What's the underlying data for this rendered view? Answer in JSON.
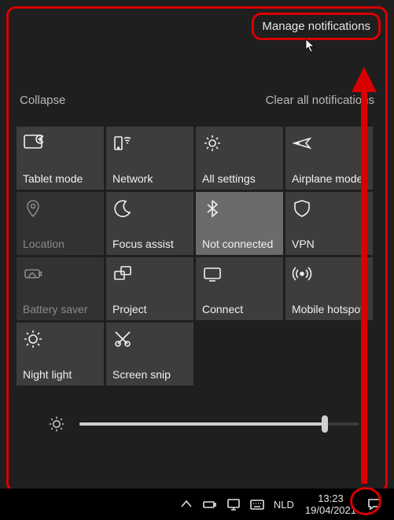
{
  "top": {
    "manage": "Manage notifications"
  },
  "actions": {
    "collapse": "Collapse",
    "clear_all": "Clear all notifications"
  },
  "tiles": {
    "tablet_mode": "Tablet mode",
    "network": "Network",
    "all_settings": "All settings",
    "airplane_mode": "Airplane mode",
    "location": "Location",
    "focus_assist": "Focus assist",
    "bluetooth": "Not connected",
    "vpn": "VPN",
    "battery_saver": "Battery saver",
    "project": "Project",
    "connect": "Connect",
    "mobile_hotspot": "Mobile hotspot",
    "night_light": "Night light",
    "screen_snip": "Screen snip"
  },
  "brightness": {
    "value_percent": 88
  },
  "tray": {
    "keyboard": "NLD",
    "time": "13:23",
    "date": "19/04/2021"
  }
}
